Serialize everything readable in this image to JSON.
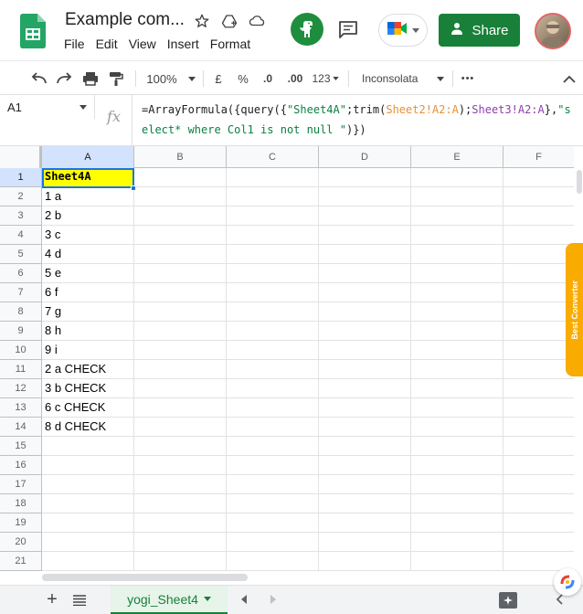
{
  "header": {
    "doc_title": "Example com...",
    "menu": [
      "File",
      "Edit",
      "View",
      "Insert",
      "Format"
    ],
    "share_label": "Share"
  },
  "toolbar": {
    "zoom": "100%",
    "currency": "£",
    "percent": "%",
    "decrease_decimal": ".0",
    "increase_decimal": ".00",
    "number_format": "123",
    "font": "Inconsolata",
    "more": "•••"
  },
  "formula_bar": {
    "name_box": "A1",
    "fx": "fx",
    "formula_parts": [
      {
        "text": "=ArrayFormula({query({",
        "cls": ""
      },
      {
        "text": "\"Sheet4A\"",
        "cls": "f-str"
      },
      {
        "text": ";trim(",
        "cls": ""
      },
      {
        "text": "Sheet2!A2:A",
        "cls": "f-ref1"
      },
      {
        "text": ");",
        "cls": ""
      },
      {
        "text": "Sheet3!A2:A",
        "cls": "f-ref2"
      },
      {
        "text": "},",
        "cls": ""
      },
      {
        "text": "\"select* where Col1 is not null \"",
        "cls": "f-str"
      },
      {
        "text": ")})",
        "cls": ""
      }
    ]
  },
  "grid": {
    "columns": [
      "A",
      "B",
      "C",
      "D",
      "E",
      "F"
    ],
    "row_numbers": [
      "1",
      "2",
      "3",
      "4",
      "5",
      "6",
      "7",
      "8",
      "9",
      "10",
      "11",
      "12",
      "13",
      "14",
      "15",
      "16",
      "17",
      "18",
      "19",
      "20",
      "21"
    ],
    "column_a": [
      "Sheet4A",
      "1 a",
      "2 b",
      "3 c",
      "4 d",
      "5 e",
      "6 f",
      "7 g",
      "8 h",
      "9 i",
      "2 a CHECK",
      "3 b CHECK",
      "6 c CHECK",
      "8 d CHECK",
      "",
      "",
      "",
      "",
      "",
      "",
      ""
    ],
    "selected_cell": "A1",
    "header_fill_color": "#ffff00"
  },
  "side_tab": {
    "label": "Best Converter"
  },
  "bottom": {
    "sheet_name": "yogi_Sheet4",
    "add_sheet": "+"
  },
  "colors": {
    "accent_green": "#188038",
    "selection_blue": "#1a73e8"
  }
}
